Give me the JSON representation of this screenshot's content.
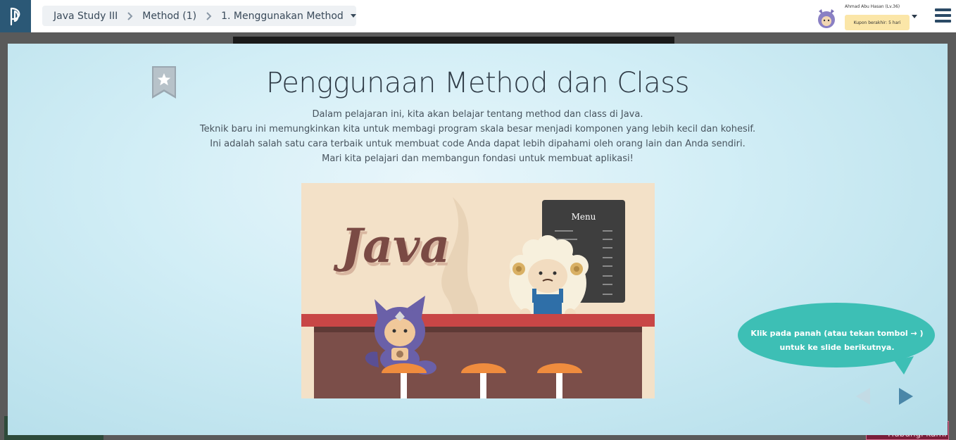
{
  "breadcrumb": {
    "course": "Java Study III",
    "chapter": "Method (1)",
    "lesson": "1. Menggunakan Method"
  },
  "user": {
    "name": "Ahmad Abu Hasan (Lv.36)",
    "coupon": "Kupon berakhir: 5 hari"
  },
  "slide": {
    "title": "Penggunaan Method dan Class",
    "lines": [
      "Dalam pelajaran ini, kita akan belajar tentang method dan class di Java.",
      "Teknik baru ini memungkinkan kita untuk membagi program skala besar menjadi komponen yang lebih kecil dan kohesif.",
      "Ini adalah salah satu cara terbaik untuk membuat code Anda dapat lebih dipahami oleh orang lain dan Anda sendiri.",
      "Mari kita pelajari dan membangun fondasi untuk membuat aplikasi!"
    ],
    "illustration": {
      "sign_text": "Java",
      "menu_title": "Menu"
    }
  },
  "hint": {
    "line1": "Klik pada panah (atau tekan tombol → )",
    "line2": "untuk ke slide berikutnya."
  },
  "background": {
    "button_label": "Hubungi kami"
  },
  "colors": {
    "brand": "#2b5876",
    "bubble": "#3dbfb5",
    "nav_arrow": "#4a86a8",
    "coupon_bg": "#fbe6a8"
  }
}
